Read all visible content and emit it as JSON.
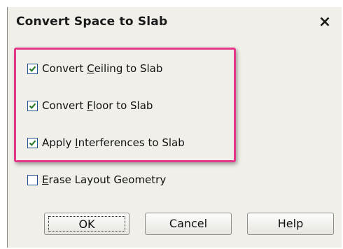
{
  "dialog": {
    "title": "Convert Space to Slab",
    "close_glyph": "×"
  },
  "options": [
    {
      "pre": "Convert ",
      "mnemonic": "C",
      "post": "eiling to Slab",
      "checked": true
    },
    {
      "pre": "Convert ",
      "mnemonic": "F",
      "post": "loor to Slab",
      "checked": true
    },
    {
      "pre": "Apply ",
      "mnemonic": "I",
      "post": "nterferences to Slab",
      "checked": true
    },
    {
      "pre": "",
      "mnemonic": "E",
      "post": "rase Layout Geometry",
      "checked": false
    }
  ],
  "buttons": {
    "ok": "OK",
    "cancel": "Cancel",
    "help": "Help"
  },
  "colors": {
    "highlight": "#e5358a",
    "check": "#2a7a2a"
  }
}
